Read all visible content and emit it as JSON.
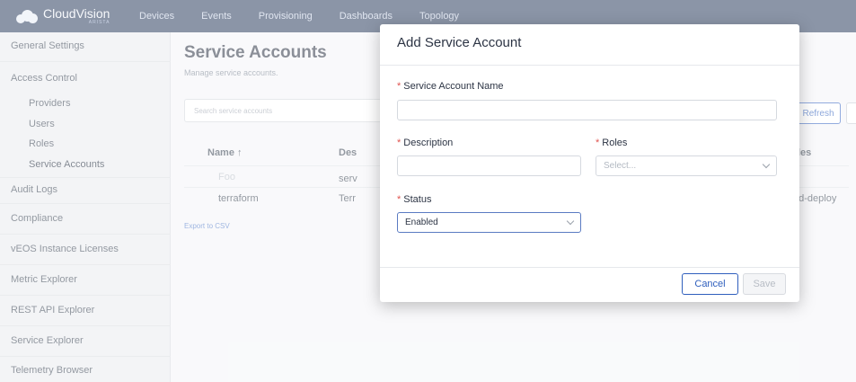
{
  "nav": {
    "brand": "CloudVision",
    "brand_sub": "ARISTA",
    "links": [
      "Devices",
      "Events",
      "Provisioning",
      "Dashboards",
      "Topology"
    ]
  },
  "sidebar": {
    "items": [
      "General Settings",
      "Access Control",
      "Providers",
      "Users",
      "Roles",
      "Service Accounts",
      "Audit Logs",
      "Compliance",
      "vEOS Instance Licenses",
      "Metric Explorer",
      "REST API Explorer",
      "Service Explorer",
      "Telemetry Browser"
    ]
  },
  "page": {
    "title": "Service Accounts",
    "subtitle": "Manage service accounts.",
    "search_placeholder": "Search service accounts",
    "refresh_label": "Refresh",
    "columns": [
      "Name ↑",
      "Des",
      "les"
    ],
    "rows": [
      {
        "name": "Foo",
        "desc": "serv",
        "roles": ""
      },
      {
        "name": "terraform",
        "desc": "Terr",
        "roles": "ud-deploy"
      }
    ],
    "export_label": "Export to CSV"
  },
  "modal": {
    "title": "Add Service Account",
    "required_mark": "*",
    "name_label": "Service Account Name",
    "name_value": "",
    "description_label": "Description",
    "description_value": "",
    "roles_label": "Roles",
    "roles_placeholder": "Select...",
    "status_label": "Status",
    "status_value": "Enabled",
    "cancel_label": "Cancel",
    "save_label": "Save"
  },
  "colors": {
    "nav_bg": "#2d3e60",
    "accent": "#2f5fbd",
    "required": "#e0534f"
  }
}
